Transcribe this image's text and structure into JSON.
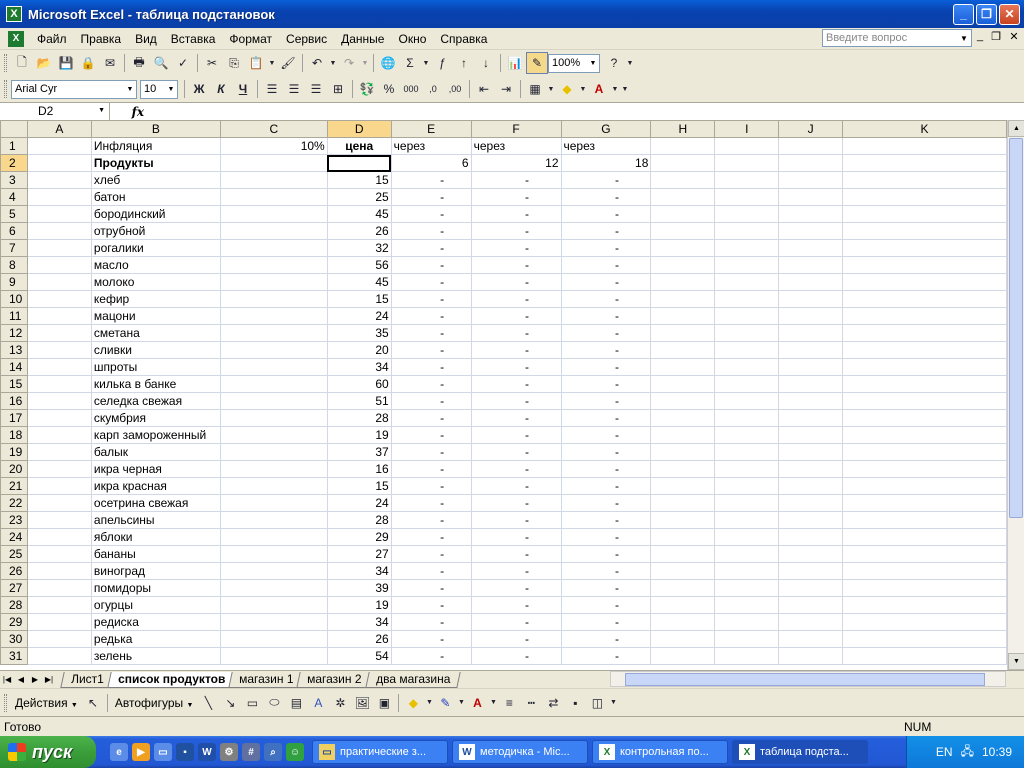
{
  "window": {
    "title": "Microsoft Excel - таблица подстановок",
    "icon": "excel-icon"
  },
  "menu": [
    "Файл",
    "Правка",
    "Вид",
    "Вставка",
    "Формат",
    "Сервис",
    "Данные",
    "Окно",
    "Справка"
  ],
  "ask": {
    "placeholder": "Введите вопрос"
  },
  "toolbar": {
    "zoom": "100%"
  },
  "format": {
    "font": "Arial Cyr",
    "size": "10"
  },
  "formula": {
    "cell_ref": "D2",
    "fx": "fx",
    "value": ""
  },
  "columns": [
    "A",
    "B",
    "C",
    "D",
    "E",
    "F",
    "G",
    "H",
    "I",
    "J",
    "K"
  ],
  "header_rows": [
    {
      "n": "1",
      "b": "Инфляция",
      "c": "10%",
      "d": "цена",
      "e": "через",
      "f": "через",
      "g": "через"
    },
    {
      "n": "2",
      "b": "Продукты",
      "c": "",
      "d": "",
      "e": "6",
      "f": "12",
      "g": "18"
    }
  ],
  "products": [
    {
      "n": "3",
      "name": "хлеб",
      "price": "15"
    },
    {
      "n": "4",
      "name": "батон",
      "price": "25"
    },
    {
      "n": "5",
      "name": "бородинский",
      "price": "45"
    },
    {
      "n": "6",
      "name": "отрубной",
      "price": "26"
    },
    {
      "n": "7",
      "name": "рогалики",
      "price": "32"
    },
    {
      "n": "8",
      "name": "масло",
      "price": "56"
    },
    {
      "n": "9",
      "name": "молоко",
      "price": "45"
    },
    {
      "n": "10",
      "name": "кефир",
      "price": "15"
    },
    {
      "n": "11",
      "name": "мацони",
      "price": "24"
    },
    {
      "n": "12",
      "name": "сметана",
      "price": "35"
    },
    {
      "n": "13",
      "name": "сливки",
      "price": "20"
    },
    {
      "n": "14",
      "name": "шпроты",
      "price": "34"
    },
    {
      "n": "15",
      "name": "килька в банке",
      "price": "60"
    },
    {
      "n": "16",
      "name": "селедка свежая",
      "price": "51"
    },
    {
      "n": "17",
      "name": "скумбрия",
      "price": "28"
    },
    {
      "n": "18",
      "name": "карп замороженный",
      "price": "19"
    },
    {
      "n": "19",
      "name": "балык",
      "price": "37"
    },
    {
      "n": "20",
      "name": "икра черная",
      "price": "16"
    },
    {
      "n": "21",
      "name": "икра красная",
      "price": "15"
    },
    {
      "n": "22",
      "name": "осетрина свежая",
      "price": "24"
    },
    {
      "n": "23",
      "name": "апельсины",
      "price": "28"
    },
    {
      "n": "24",
      "name": "яблоки",
      "price": "29"
    },
    {
      "n": "25",
      "name": "бананы",
      "price": "27"
    },
    {
      "n": "26",
      "name": "виноград",
      "price": "34"
    },
    {
      "n": "27",
      "name": "помидоры",
      "price": "39"
    },
    {
      "n": "28",
      "name": "огурцы",
      "price": "19"
    },
    {
      "n": "29",
      "name": "редиска",
      "price": "34"
    },
    {
      "n": "30",
      "name": "редька",
      "price": "26"
    },
    {
      "n": "31",
      "name": "зелень",
      "price": "54"
    }
  ],
  "dash": "-",
  "tabs": [
    "Лист1",
    "список продуктов",
    "магазин 1",
    "магазин 2",
    "два магазина"
  ],
  "active_tab": "список продуктов",
  "drawing": {
    "actions": "Действия",
    "autoshapes": "Автофигуры"
  },
  "status": {
    "ready": "Готово",
    "num": "NUM"
  },
  "taskbar": {
    "start": "пуск",
    "buttons": [
      {
        "label": "практические з...",
        "icon": "folder-icon"
      },
      {
        "label": "методичка - Mic...",
        "icon": "word-icon"
      },
      {
        "label": "контрольная по...",
        "icon": "excel-icon"
      },
      {
        "label": "таблица подста...",
        "icon": "excel-icon"
      }
    ],
    "lang": "EN",
    "clock": "10:39"
  }
}
